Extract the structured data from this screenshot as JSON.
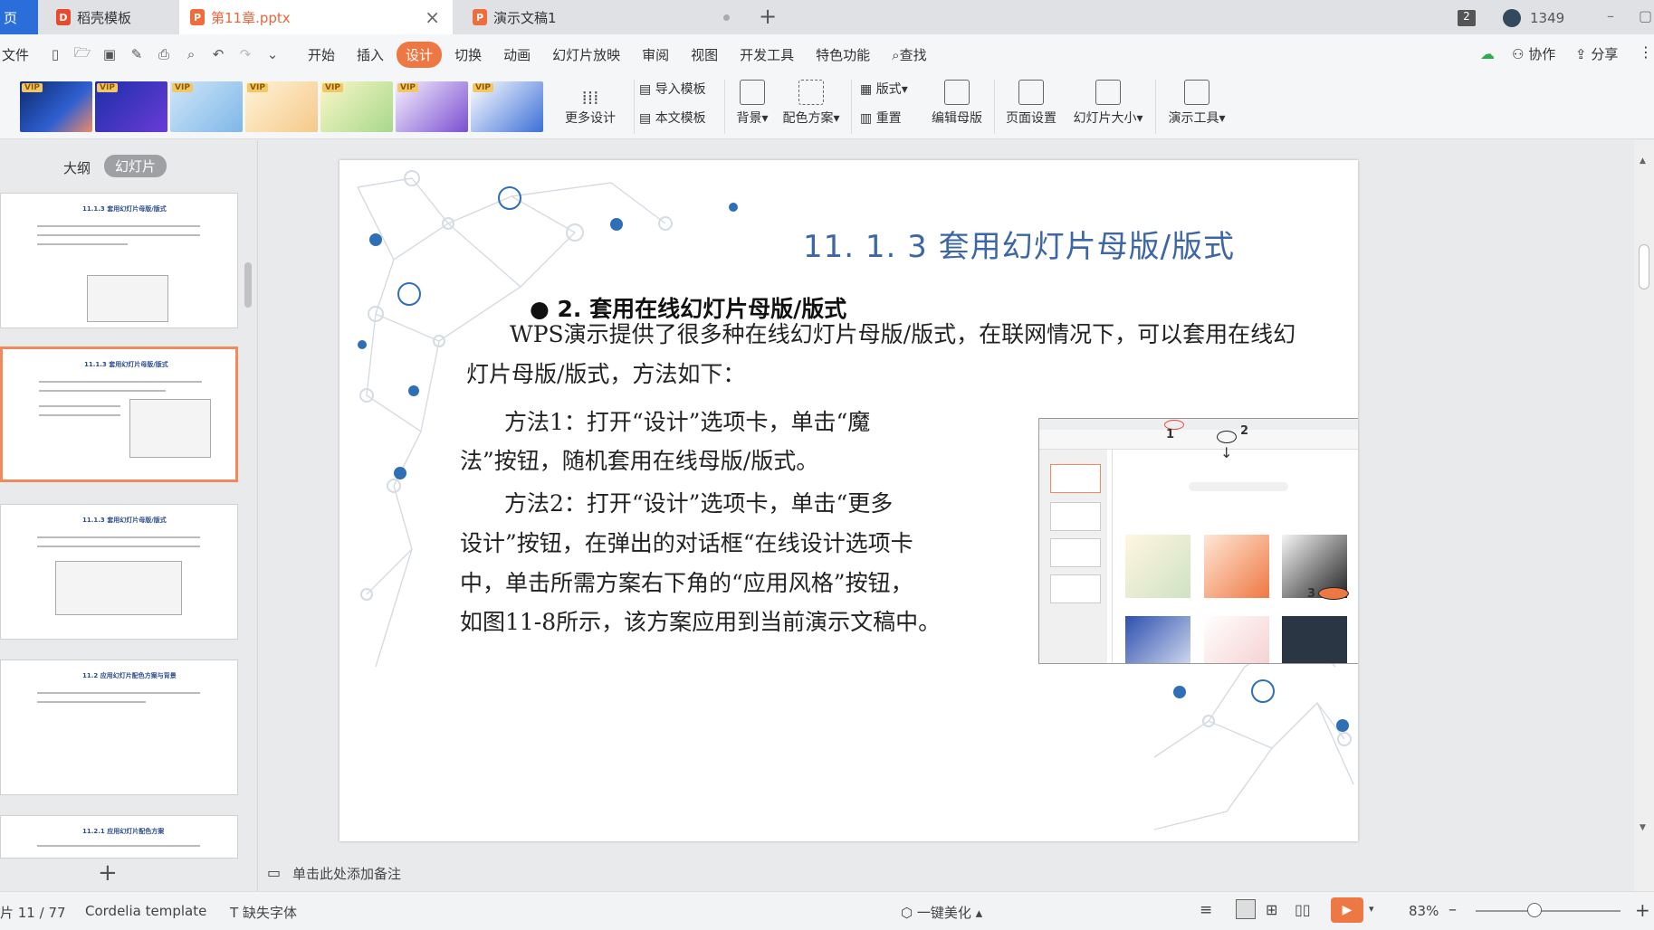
{
  "tabs": [
    {
      "label": "页",
      "kind": "home"
    },
    {
      "label": "稻壳模板",
      "kind": "docer"
    },
    {
      "label": "第11章.pptx",
      "kind": "ppt"
    },
    {
      "label": "演示文稿1",
      "kind": "ppt"
    }
  ],
  "window": {
    "badge": "2",
    "user_count": "1349"
  },
  "menu": {
    "file": "文件",
    "items": [
      "开始",
      "插入",
      "设计",
      "切换",
      "动画",
      "幻灯片放映",
      "审阅",
      "视图",
      "开发工具",
      "特色功能"
    ],
    "active": "设计",
    "search": "查找",
    "collab": "协作",
    "share": "分享"
  },
  "ribbon": {
    "vip": "VIP",
    "more_design": "更多设计",
    "import_template": "导入模板",
    "this_template": "本文模板",
    "background": "背景",
    "color_scheme": "配色方案",
    "layout": "版式",
    "reset": "重置",
    "edit_master": "编辑母版",
    "page_setup": "页面设置",
    "slide_size": "幻灯片大小",
    "present_tools": "演示工具"
  },
  "left_panel": {
    "tab_outline": "大纲",
    "tab_slides": "幻灯片",
    "thumbs": [
      {
        "title": "11.1.3 套用幻灯片母版/版式"
      },
      {
        "title": "11.1.3 套用幻灯片母版/版式"
      },
      {
        "title": "11.1.3 套用幻灯片母版/版式"
      },
      {
        "title": "11.2 应用幻灯片配色方案与背景"
      },
      {
        "title": "11.2.1 应用幻灯片配色方案"
      }
    ],
    "add": "+"
  },
  "slide": {
    "title": "11. 1. 3  套用幻灯片母版/版式",
    "subtitle": "2. 套用在线幻灯片母版/版式",
    "p1_line1": "WPS演示提供了很多种在线幻灯片母版/版式，在联网情况下，可以套用在线幻",
    "p1_line2": "灯片母版/版式，方法如下：",
    "p2_line1": "方法1：打开“设计”选项卡，单击“魔",
    "p2_line2": "法”按钮，随机套用在线母版/版式。",
    "p3_line1": "方法2：打开“设计”选项卡，单击“更多",
    "p3_line2": "设计”按钮，在弹出的对话框“在线设计选项卡",
    "p3_line3": "中，单击所需方案右下角的“应用风格”按钮，",
    "p3_line4": "如图11-8所示，该方案应用到当前演示文稿中。",
    "callouts": [
      "1",
      "2",
      "3"
    ]
  },
  "notes": {
    "placeholder": "单击此处添加备注"
  },
  "status": {
    "page": "片 11 / 77",
    "template": "Cordelia template",
    "missing_font": "缺失字体",
    "beautify": "一键美化",
    "zoom": "83%"
  },
  "colors": {
    "accent": "#ee7843",
    "title_blue": "#3c66a6",
    "dot_blue": "#2f6fb5"
  }
}
